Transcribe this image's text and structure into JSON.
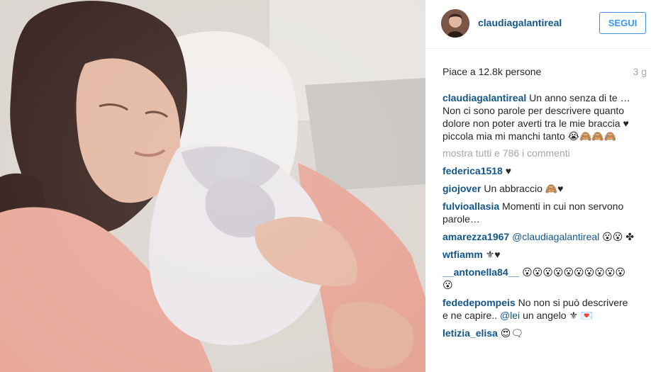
{
  "post": {
    "username": "claudiagalantireal",
    "follow_label": "SEGUI",
    "likes_text": "Piace a 12.8k persone",
    "time_ago": "3 g",
    "caption": {
      "username": "claudiagalantireal",
      "text": "Un anno senza di te … Non ci sono parole per descrivere quanto dolore non poter averti tra le mie braccia ♥ piccola mia mi manchi tanto 😭🙈🙈🙈"
    },
    "view_all_comments": "mostra tutti e 786 i commenti",
    "comments": [
      {
        "username": "federica1518",
        "text": "♥"
      },
      {
        "username": "giojover",
        "text": "Un abbraccio 🙈♥"
      },
      {
        "username": "fulvioallasia",
        "text": "Momenti in cui non servono parole…"
      },
      {
        "username": "amarezza1967",
        "mention": "@claudiagalantireal",
        "text": "😮😮 ✤"
      },
      {
        "username": "wtfiamm",
        "text": "⚜♥"
      },
      {
        "username": "__antonella84__",
        "text": "😮😮😮😮😮😮😮😮😮😮😮"
      },
      {
        "username": "fededepompeis",
        "text": "No non si può descrivere e ne capire..",
        "mention": "@lei",
        "text2": "un angelo ⚜ 💌"
      },
      {
        "username": "letizia_elisa",
        "text": "😍🗨"
      }
    ]
  },
  "colors": {
    "username": "#125688",
    "follow_border": "#4090db",
    "follow_text": "#3897f0",
    "muted": "#a5a7aa"
  }
}
